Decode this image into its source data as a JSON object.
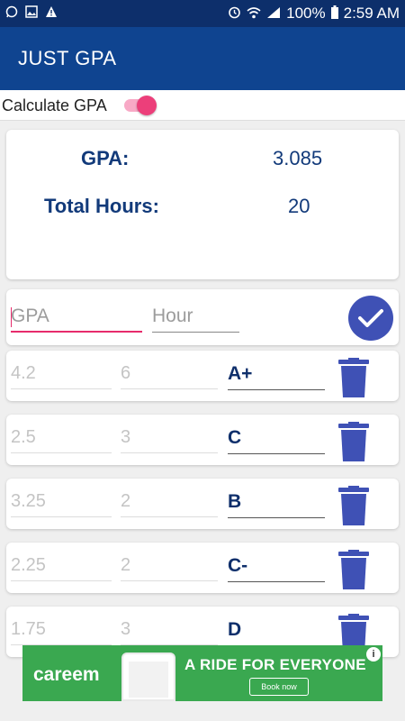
{
  "status_bar": {
    "left_icons": [
      "whatsapp-icon",
      "image-icon",
      "warning-icon"
    ],
    "right_icons": [
      "alarm-icon",
      "wifi-icon",
      "signal-icon"
    ],
    "battery": "100%",
    "time": "2:59 AM"
  },
  "appbar": {
    "title": "JUST GPA"
  },
  "toggle": {
    "label": "Calculate GPA",
    "on": true
  },
  "summary": {
    "gpa_label": "GPA:",
    "gpa_value": "3.085",
    "hours_label": "Total Hours:",
    "hours_value": "20"
  },
  "entry": {
    "gpa_placeholder": "GPA",
    "hour_placeholder": "Hour",
    "submit_icon": "check-icon"
  },
  "courses": [
    {
      "gpa": "4.2",
      "hours": "6",
      "grade": "A+"
    },
    {
      "gpa": "2.5",
      "hours": "3",
      "grade": "C"
    },
    {
      "gpa": "3.25",
      "hours": "2",
      "grade": "B"
    },
    {
      "gpa": "2.25",
      "hours": "2",
      "grade": "C-"
    },
    {
      "gpa": "1.75",
      "hours": "3",
      "grade": "D"
    }
  ],
  "ad": {
    "brand": "careem",
    "headline": "A RIDE FOR EVERYONE",
    "cta": "Book now",
    "info": "i"
  },
  "colors": {
    "statusbar": "#0d2f6b",
    "appbar": "#0f4490",
    "accent": "#ec3f7a",
    "primary": "#3f51b5",
    "ad": "#3aa850"
  }
}
